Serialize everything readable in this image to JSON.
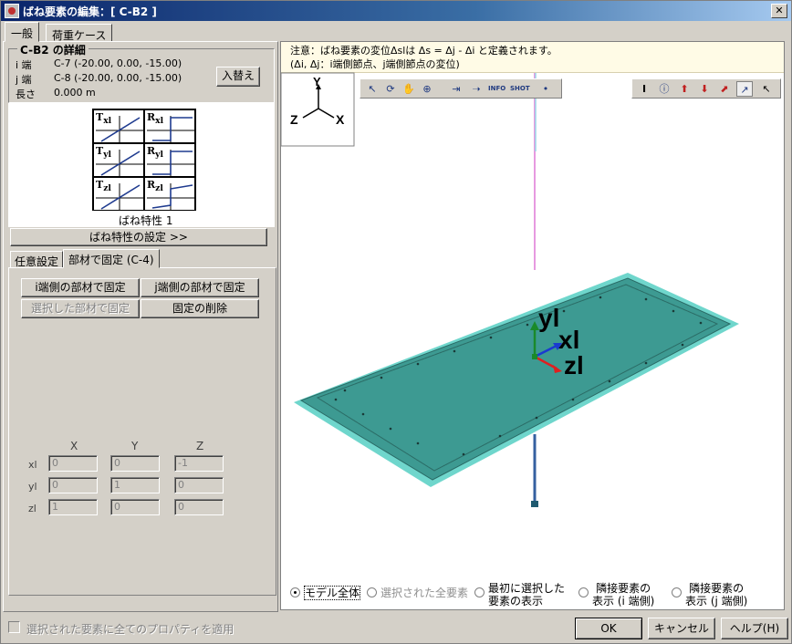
{
  "window": {
    "title": "ばね要素の編集：[ C-B2 ]",
    "close_label": "✕"
  },
  "tabs": [
    {
      "label": "一般"
    },
    {
      "label": "荷重ケース"
    }
  ],
  "details": {
    "title": "C-B2 の詳細",
    "i_label": "i 端",
    "i_value": "C-7 (-20.00, 0.00, -15.00)",
    "j_label": "j 端",
    "j_value": "C-8 (-20.00, 0.00, -15.00)",
    "len_label": "長さ",
    "len_value": "0.000 m",
    "swap_button": "入替え"
  },
  "spring": {
    "cells": [
      {
        "sym": "T",
        "sub": "xl",
        "kind": "linear"
      },
      {
        "sym": "R",
        "sub": "xl",
        "kind": "step"
      },
      {
        "sym": "T",
        "sub": "yl",
        "kind": "linear"
      },
      {
        "sym": "R",
        "sub": "yl",
        "kind": "step"
      },
      {
        "sym": "T",
        "sub": "zl",
        "kind": "linear"
      },
      {
        "sym": "R",
        "sub": "zl",
        "kind": "bilinear"
      }
    ],
    "caption": "ばね特性 1",
    "settings_button": "ばね特性の設定 >>"
  },
  "subtabs": [
    {
      "label": "任意設定"
    },
    {
      "label": "部材で固定 (C-4)"
    }
  ],
  "fix_buttons": {
    "i_side": "i端側の部材で固定",
    "j_side": "j端側の部材で固定",
    "selected": "選択した部材で固定",
    "delete": "固定の削除"
  },
  "matrix": {
    "col_headers": [
      "X",
      "Y",
      "Z"
    ],
    "rows": [
      {
        "label": "xl",
        "values": [
          "0",
          "0",
          "-1"
        ]
      },
      {
        "label": "yl",
        "values": [
          "0",
          "1",
          "0"
        ]
      },
      {
        "label": "zl",
        "values": [
          "1",
          "0",
          "0"
        ]
      }
    ]
  },
  "note": {
    "line1": "注意：ばね要素の変位Δslは Δs = Δj - Δi と定義されます。",
    "line2": "(Δi, Δj：i端側節点、j端側節点の変位)"
  },
  "axes_labels": {
    "y": "Y",
    "z": "Z",
    "x": "X"
  },
  "local_axes": {
    "y": "yl",
    "x": "xl",
    "z": "zl"
  },
  "view_options": [
    {
      "label": "モデル全体",
      "checked": true,
      "disabled": false
    },
    {
      "label": "選択された全要素",
      "checked": false,
      "disabled": true
    },
    {
      "label": "最初に選択した\n要素の表示",
      "checked": false,
      "disabled": false
    },
    {
      "label": "隣接要素の\n表示 (i 端側)",
      "checked": false,
      "disabled": false
    },
    {
      "label": "隣接要素の\n表示 (j 端側)",
      "checked": false,
      "disabled": false
    }
  ],
  "apply_all": {
    "label": "選択された要素に全てのプロパティを適用",
    "checked": false
  },
  "footer": {
    "ok": "OK",
    "cancel": "キャンセル",
    "help": "ヘルプ(H)"
  },
  "colors": {
    "plate": "#3d9a92",
    "plate_edge": "#6fd6cc",
    "column_top": "#e79ae0",
    "column_bottom": "#3560a0",
    "axis_y": "#1a8a2a",
    "axis_x": "#1a3ad0",
    "axis_z": "#e02020"
  }
}
